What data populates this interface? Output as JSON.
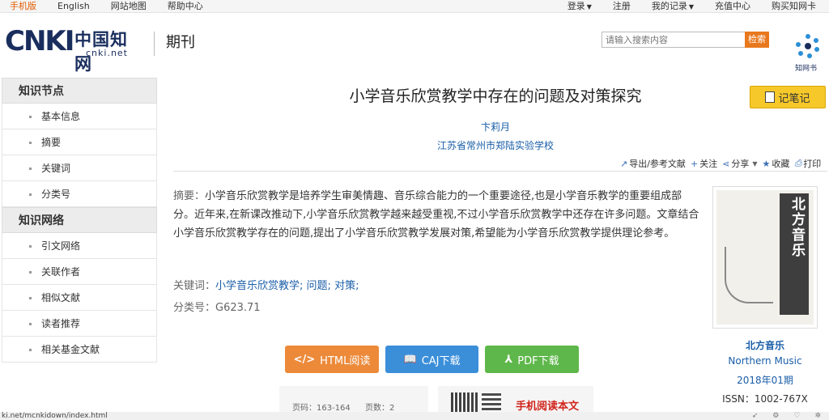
{
  "topbar": {
    "left": [
      "手机版",
      "English",
      "网站地图",
      "帮助中心"
    ],
    "right": [
      "登录",
      "注册",
      "我的记录",
      "充值中心",
      "购买知网卡"
    ]
  },
  "header": {
    "logo_text": "CNKI",
    "logo_zh": "中国知网",
    "logo_url": "cnki.net",
    "section": "期刊",
    "search_placeholder": "请输入搜索内容",
    "search_button": "检索",
    "zw_logo_text": "知网书"
  },
  "sidebar": {
    "groups": [
      {
        "title": "知识节点",
        "items": [
          "基本信息",
          "摘要",
          "关键词",
          "分类号"
        ]
      },
      {
        "title": "知识网络",
        "items": [
          "引文网络",
          "关联作者",
          "相似文献",
          "读者推荐",
          "相关基金文献"
        ]
      }
    ]
  },
  "article": {
    "title": "小学音乐欣赏教学中存在的问题及对策探究",
    "author": "卞莉月",
    "org": "江苏省常州市郑陆实验学校",
    "note_button": "记笔记",
    "actions": [
      "导出/参考文献",
      "关注",
      "分享",
      "收藏",
      "打印"
    ],
    "abstract_label": "摘要：",
    "abstract": "小学音乐欣赏教学是培养学生审美情趣、音乐综合能力的一个重要途径,也是小学音乐教学的重要组成部分。近年来,在新课改推动下,小学音乐欣赏教学越来越受重视,不过小学音乐欣赏教学中还存在许多问题。文章结合小学音乐欣赏教学存在的问题,提出了小学音乐欣赏教学发展对策,希望能为小学音乐欣赏教学提供理论参考。",
    "keywords_label": "关键词：",
    "keywords": [
      "小学音乐欣赏教学;",
      "问题;",
      "对策;"
    ],
    "class_label": "分类号：",
    "class_no": "G623.71"
  },
  "buttons": {
    "html": "HTML阅读",
    "caj": "CAJ下载",
    "pdf": "PDF下载"
  },
  "info": {
    "pages": "页码：163-164",
    "page_count": "页数：2",
    "mobile": "手机阅读本文"
  },
  "journal": {
    "cover_title": "北方音乐",
    "name": "北方音乐",
    "name_en": "Northern Music",
    "issue": "2018年01期",
    "issn": "ISSN：1002-767X"
  },
  "status": {
    "url": "ki.net/mcnkidown/index.html"
  },
  "colors": {
    "accent_orange": "#e8781e",
    "link_blue": "#1a5ea8",
    "html_btn": "#ec8a3a",
    "caj_btn": "#3b8fd9",
    "pdf_btn": "#5eb74a",
    "note_btn": "#f6c829",
    "mobile_red": "#d0241b"
  }
}
